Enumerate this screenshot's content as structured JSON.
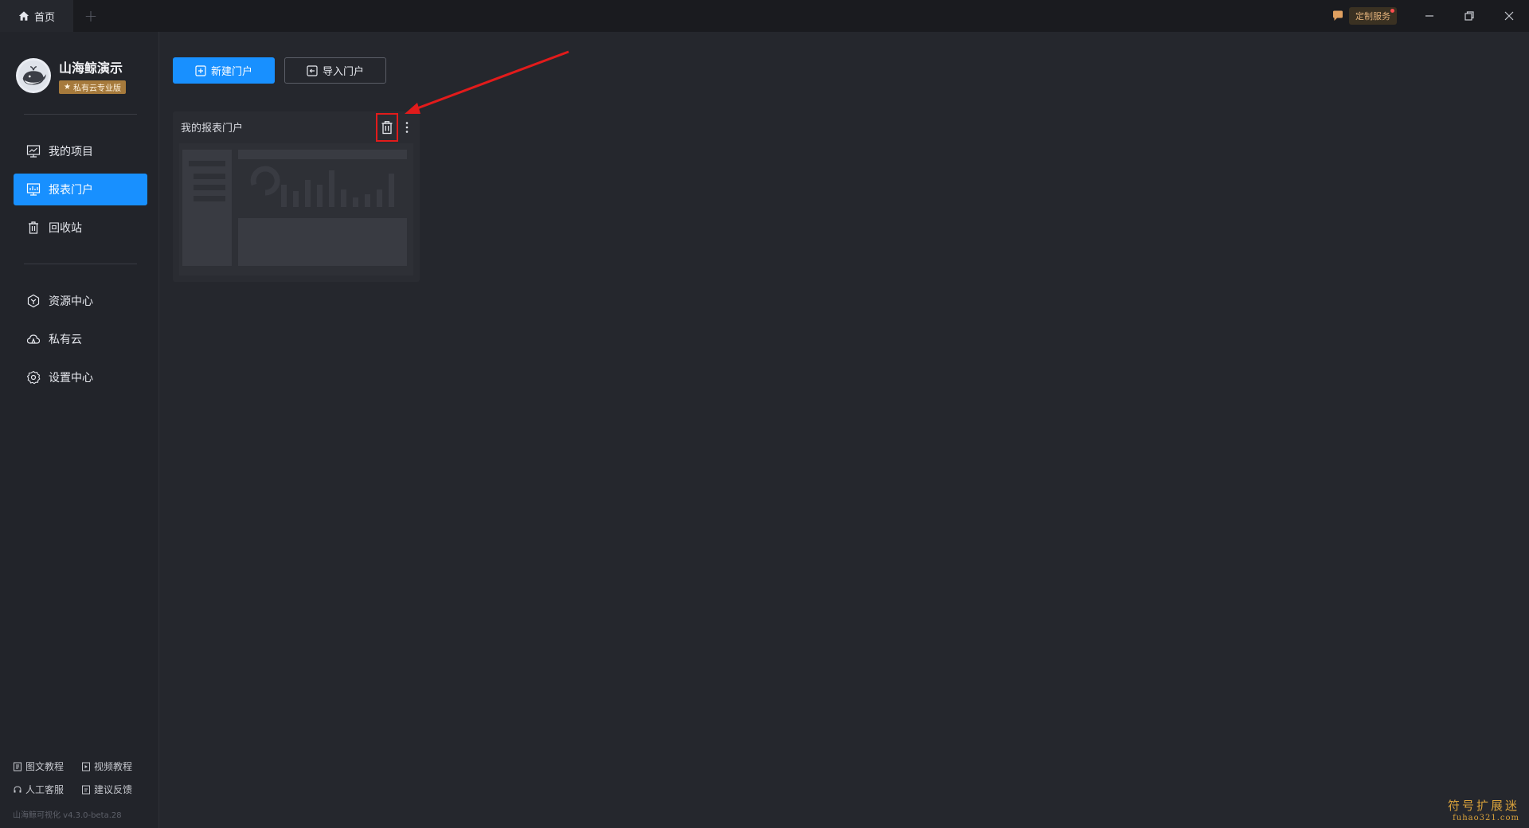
{
  "titlebar": {
    "home_tab": "首页",
    "add_tab": "+",
    "custom_service": "定制服务"
  },
  "sidebar": {
    "profile": {
      "name": "山海鲸演示",
      "badge": "私有云专业版"
    },
    "nav_primary": [
      {
        "label": "我的项目",
        "icon": "chart-board-icon",
        "active": false
      },
      {
        "label": "报表门户",
        "icon": "portal-icon",
        "active": true
      },
      {
        "label": "回收站",
        "icon": "trash-icon",
        "active": false
      }
    ],
    "nav_secondary": [
      {
        "label": "资源中心",
        "icon": "hexagon-icon"
      },
      {
        "label": "私有云",
        "icon": "cloud-icon"
      },
      {
        "label": "设置中心",
        "icon": "gear-icon"
      }
    ],
    "footer_links": [
      {
        "label": "图文教程",
        "icon": "doc-icon"
      },
      {
        "label": "视频教程",
        "icon": "video-icon"
      },
      {
        "label": "人工客服",
        "icon": "headset-icon"
      },
      {
        "label": "建议反馈",
        "icon": "feedback-icon"
      }
    ],
    "version": "山海鲸可视化 v4.3.0-beta.28"
  },
  "toolbar": {
    "new_portal": "新建门户",
    "import_portal": "导入门户"
  },
  "portals": [
    {
      "title": "我的报表门户"
    }
  ],
  "watermark": {
    "cn": "符号扩展迷",
    "en": "fuhao321.com"
  },
  "colors": {
    "accent": "#1890ff",
    "background": "#25272d",
    "sidebar": "#22242a",
    "highlight_box": "#e21b1b",
    "badge": "#a67a3c"
  }
}
